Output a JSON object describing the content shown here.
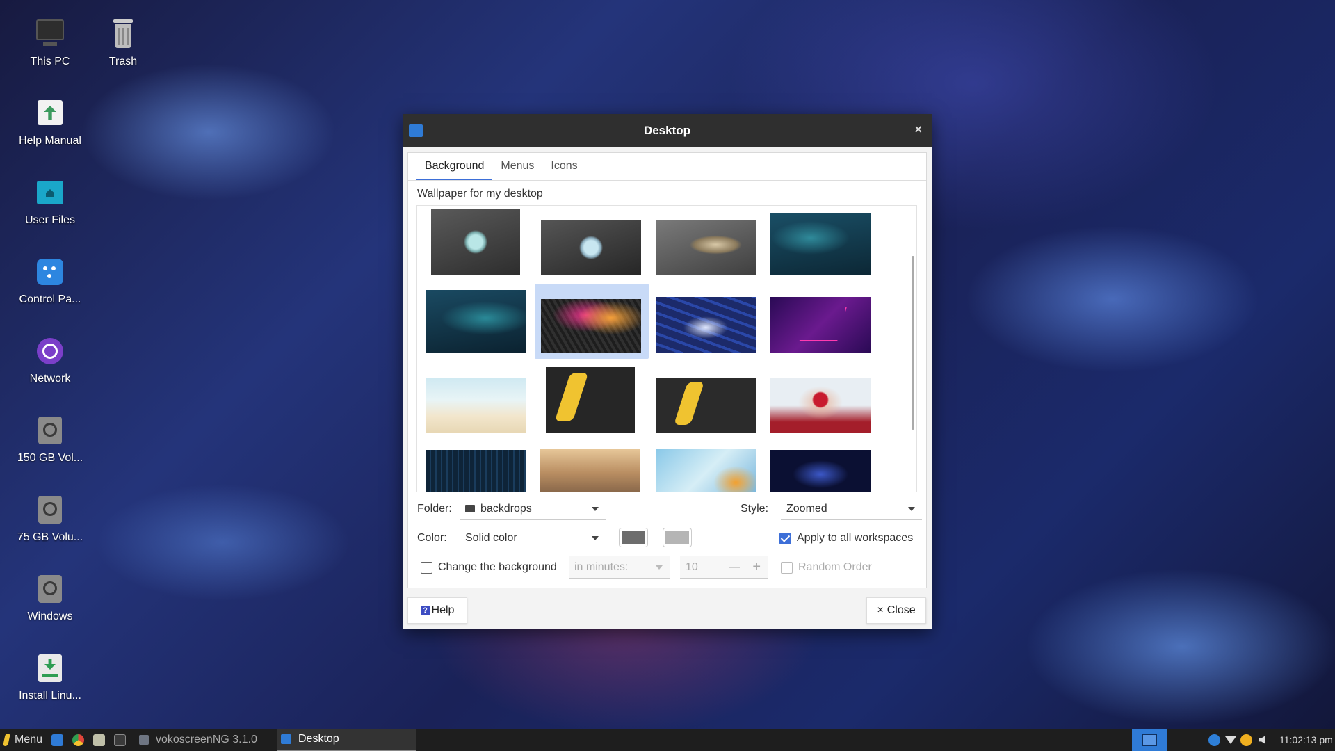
{
  "desktop_icons": [
    {
      "label": "This PC",
      "icon": "computer-icon"
    },
    {
      "label": "Trash",
      "icon": "trash-icon"
    },
    {
      "label": "Help Manual",
      "icon": "help-manual-icon"
    },
    {
      "label": "User Files",
      "icon": "home-folder-icon"
    },
    {
      "label": "Control Pa...",
      "icon": "control-panel-icon"
    },
    {
      "label": "Network",
      "icon": "network-icon"
    },
    {
      "label": "150 GB Vol...",
      "icon": "disk-icon"
    },
    {
      "label": "75 GB Volu...",
      "icon": "disk-icon"
    },
    {
      "label": "Windows",
      "icon": "disk-icon"
    },
    {
      "label": "Install Linu...",
      "icon": "install-icon"
    }
  ],
  "dialog": {
    "title": "Desktop",
    "close_glyph": "×",
    "tabs": [
      "Background",
      "Menus",
      "Icons"
    ],
    "active_tab": "Background",
    "section_title": "Wallpaper for my desktop",
    "wallpapers": [
      "gray-orb",
      "gray-orb-dark",
      "robot-hand",
      "aurora-teal",
      "aurora-teal-2",
      "hexagon-pink",
      "blue-keyboard",
      "neon-triangle",
      "tropical-beach",
      "yellow-feather",
      "yellow-feather-2",
      "heart-hands",
      "circuit-board",
      "mountain-sunrise",
      "abstract-flower",
      "blue-network"
    ],
    "selected_wallpaper": "hexagon-pink",
    "folder_label": "Folder:",
    "folder_value": "backdrops",
    "style_label": "Style:",
    "style_value": "Zoomed",
    "color_label": "Color:",
    "color_value": "Solid color",
    "color_primary": "#6d6d6d",
    "color_secondary": "#b5b5b5",
    "apply_all_label": "Apply to all workspaces",
    "apply_all_checked": true,
    "change_bg_label": "Change the background",
    "change_bg_checked": false,
    "interval_unit": "in minutes:",
    "interval_value": "10",
    "minus_glyph": "—",
    "plus_glyph": "+",
    "random_order_label": "Random Order",
    "help_label": "Help",
    "help_glyph": "?",
    "close_label": "Close",
    "close_button_glyph": "×"
  },
  "taskbar": {
    "menu_label": "Menu",
    "windows": [
      {
        "label": "vokoscreenNG 3.1.0",
        "active": false
      },
      {
        "label": "Desktop",
        "active": true
      }
    ],
    "clock": "11:02:13 pm"
  },
  "colors": {
    "accent": "#3d6fd8",
    "titlebar": "#2f2f2f",
    "taskbar": "#1e1e1e"
  }
}
